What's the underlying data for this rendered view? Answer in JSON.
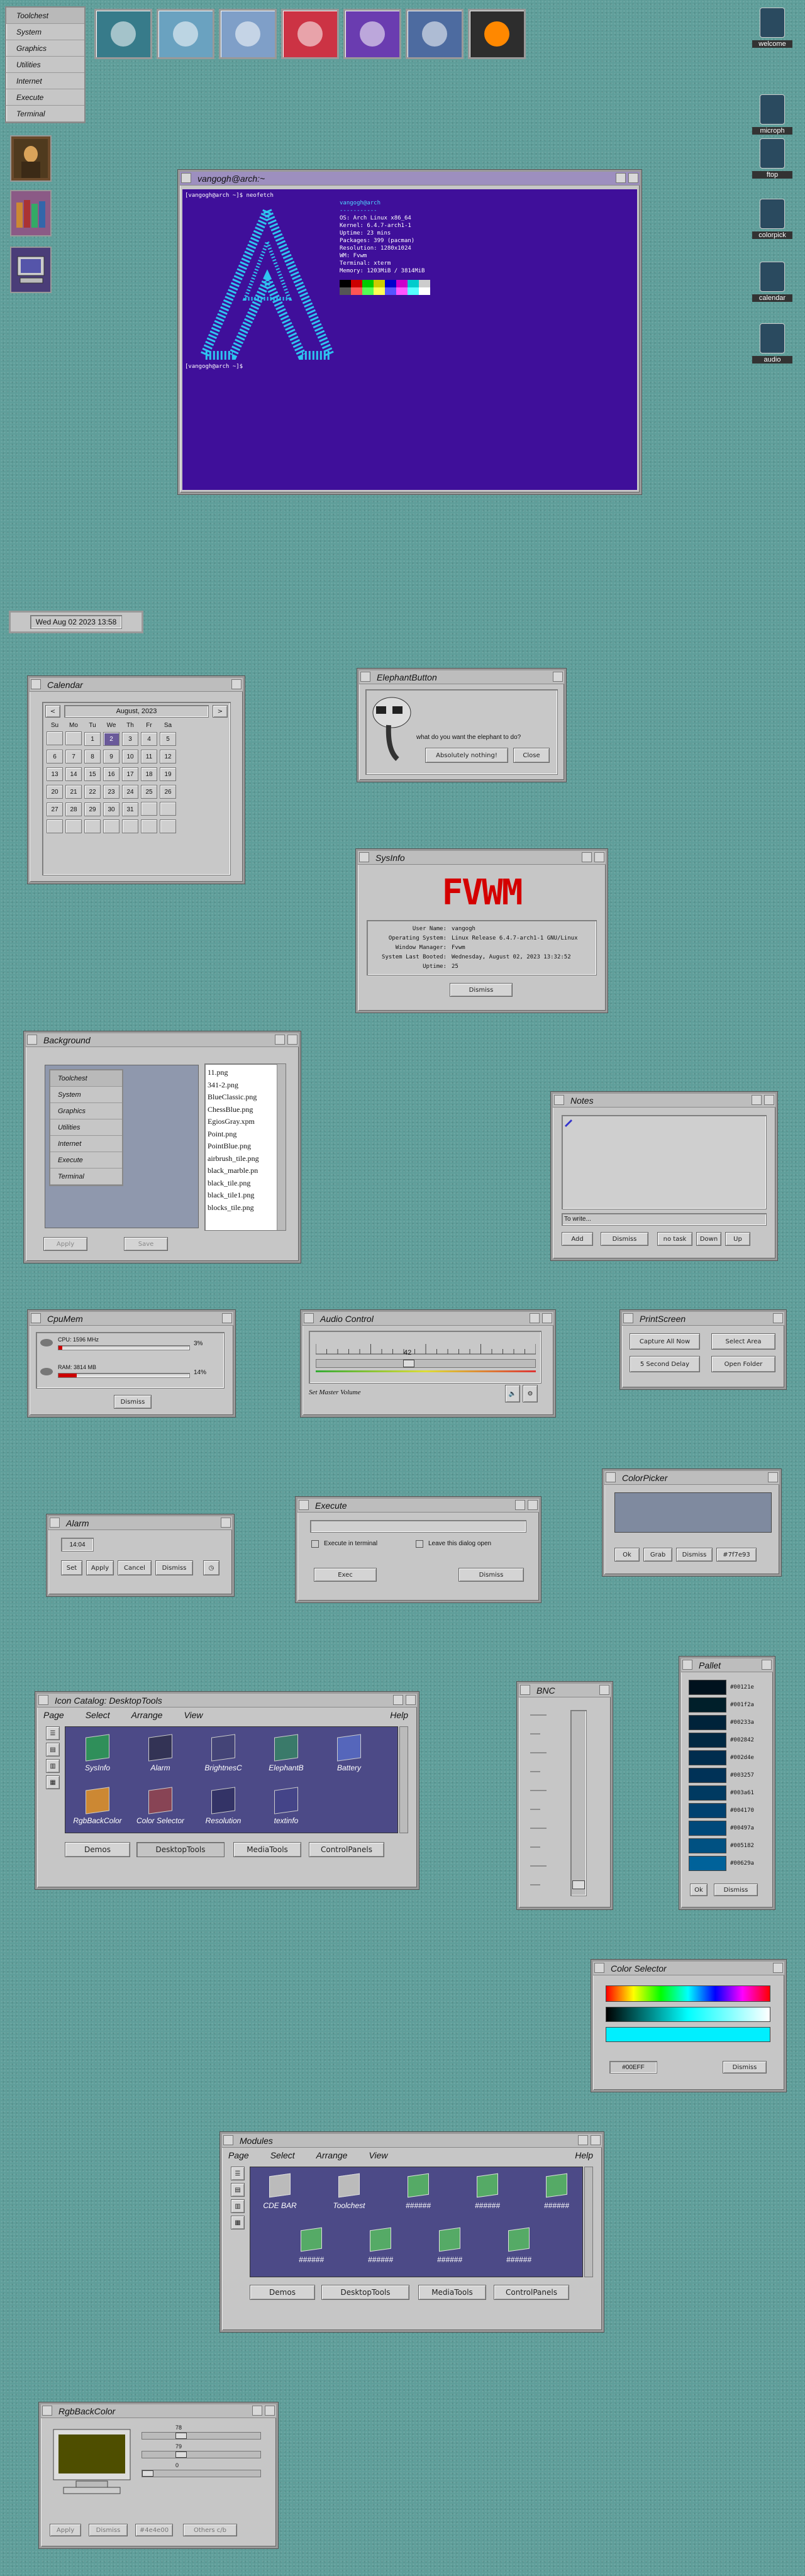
{
  "toolchest": {
    "items": [
      "Toolchest",
      "System",
      "Graphics",
      "Utilities",
      "Internet",
      "Execute",
      "Terminal"
    ]
  },
  "clock": {
    "text": "Wed Aug 02 2023 13:58"
  },
  "desktop_icons": [
    "welcome",
    "microph",
    "ftop",
    "colorpick",
    "calendar",
    "audio"
  ],
  "terminal": {
    "title": "vangogh@arch:~",
    "prompt1": "[vangogh@arch ~]$ neofetch",
    "user": "vangogh@arch",
    "os": "OS: Arch Linux x86_64",
    "kernel": "Kernel: 6.4.7-arch1-1",
    "uptime": "Uptime: 23 mins",
    "packages": "Packages: 399 (pacman)",
    "resolution": "Resolution: 1280x1024",
    "wm": "WM: Fvwm",
    "terminal": "Terminal: xterm",
    "memory": "Memory: 1203MiB / 3814MiB",
    "prompt2": "[vangogh@arch ~]$ "
  },
  "calendar": {
    "title": "Calendar",
    "month": "August, 2023",
    "prev": "<",
    "next": ">",
    "weekdays": [
      "Su",
      "Mo",
      "Tu",
      "We",
      "Th",
      "Fr",
      "Sa"
    ],
    "weeks": [
      [
        "",
        "",
        "1",
        "2",
        "3",
        "4",
        "5"
      ],
      [
        "6",
        "7",
        "8",
        "9",
        "10",
        "11",
        "12"
      ],
      [
        "13",
        "14",
        "15",
        "16",
        "17",
        "18",
        "19"
      ],
      [
        "20",
        "21",
        "22",
        "23",
        "24",
        "25",
        "26"
      ],
      [
        "27",
        "28",
        "29",
        "30",
        "31",
        "",
        ""
      ],
      [
        "",
        "",
        "",
        "",
        "",
        "",
        ""
      ]
    ]
  },
  "elephant": {
    "title": "ElephantButton",
    "question": "what do you want the elephant to do?",
    "opt1": "Absolutely nothing!",
    "opt2": "Close"
  },
  "sysinfo": {
    "title": "SysInfo",
    "logo": "FVWM",
    "labels": [
      "User Name:",
      "Operating System:",
      "Window Manager:",
      "System Last Booted:",
      "Uptime:"
    ],
    "values": [
      "vangogh",
      "Linux Release 6.4.7-arch1-1 GNU/Linux",
      "Fvwm",
      "Wednesday, August 02, 2023 13:32:52",
      "25"
    ],
    "dismiss": "Dismiss"
  },
  "background": {
    "title": "Background",
    "menu": [
      "Toolchest",
      "System",
      "Graphics",
      "Utilities",
      "Internet",
      "Execute",
      "Terminal"
    ],
    "files": [
      "11.png",
      "341-2.png",
      "BlueClassic.png",
      "ChessBlue.png",
      "EgiosGray.xpm",
      "Point.png",
      "PointBlue.png",
      "airbrush_tile.png",
      "black_marble.pn",
      "black_tile.png",
      "black_tile1.png",
      "blocks_tile.png"
    ],
    "apply": "Apply",
    "save": "Save"
  },
  "notes": {
    "title": "Notes",
    "placeholder": "To write...",
    "buttons": [
      "Add",
      "Dismiss",
      "no task",
      "Down",
      "Up"
    ]
  },
  "cpumem": {
    "title": "CpuMem",
    "cpu_label": "CPU: 1596 MHz",
    "cpu_pct": "3%",
    "cpu_val": 0.03,
    "ram_label": "RAM: 3814 MB",
    "ram_pct": "14%",
    "ram_val": 0.14,
    "dismiss": "Dismiss"
  },
  "audio": {
    "title": "Audio Control",
    "value": "42",
    "footer": "Set Master Volume"
  },
  "printscreen": {
    "title": "PrintScreen",
    "buttons": [
      "Capture All Now",
      "Select Area",
      "5 Second Delay",
      "Open Folder"
    ]
  },
  "alarm": {
    "title": "Alarm",
    "time": "14:04",
    "buttons": [
      "Set",
      "Apply",
      "Cancel",
      "Dismiss"
    ]
  },
  "execute": {
    "title": "Execute",
    "check1": "Execute in terminal",
    "check2": "Leave this dialog open",
    "exec": "Exec",
    "dismiss": "Dismiss"
  },
  "colorpicker": {
    "title": "ColorPicker",
    "swatch": "#7F8A9F",
    "buttons": [
      "Ok",
      "Grab",
      "Dismiss",
      "#7f7e93"
    ]
  },
  "iconcatalog": {
    "title": "Icon Catalog: DesktopTools",
    "menu": [
      "Page",
      "Select",
      "Arrange",
      "View"
    ],
    "help": "Help",
    "icons": [
      "SysInfo",
      "Alarm",
      "BrightnesC",
      "ElephantB",
      "Battery",
      "RgbBackColor",
      "Color Selector",
      "Resolution",
      "textinfo"
    ],
    "tabs": [
      "Demos",
      "DesktopTools",
      "MediaTools",
      "ControlPanels"
    ]
  },
  "bnc": {
    "title": "BNC"
  },
  "pallet": {
    "title": "Pallet",
    "colors": [
      "#00121e",
      "#001f2a",
      "#00233a",
      "#002842",
      "#002d4e",
      "#003257",
      "#003a61",
      "#004170",
      "#00497a",
      "#005182",
      "#00629a"
    ],
    "ok": "Ok",
    "dismiss": "Dismiss"
  },
  "colorselector": {
    "title": "Color Selector",
    "hex": "#00EFF",
    "dismiss": "Dismiss"
  },
  "modules": {
    "title": "Modules",
    "menu": [
      "Page",
      "Select",
      "Arrange",
      "View"
    ],
    "help": "Help",
    "icons": [
      "CDE BAR",
      "Toolchest",
      "######",
      "######",
      "######",
      "######",
      "######",
      "######",
      "######"
    ],
    "tabs": [
      "Demos",
      "DesktopTools",
      "MediaTools",
      "ControlPanels"
    ]
  },
  "rgbback": {
    "title": "RgbBackColor",
    "values": [
      "78",
      "79",
      "0"
    ],
    "buttons": [
      "Apply",
      "Dismiss",
      "#4e4e00",
      "Others c/b"
    ]
  }
}
